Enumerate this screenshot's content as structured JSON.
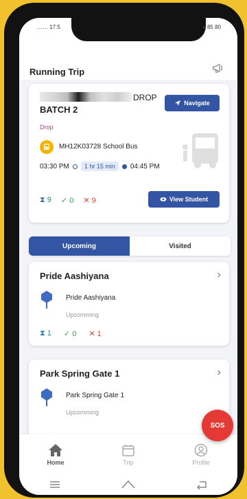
{
  "status": {
    "left": "…… 17:5",
    "right": "● 85 80"
  },
  "header": {
    "title": "Running Trip"
  },
  "trip": {
    "trip_type": "DROP",
    "batch": "BATCH 2",
    "navigate_label": "Navigate",
    "drop_label": "Drop",
    "vehicle": "MH12K03728 School Bus",
    "start_time": "03:30 PM",
    "duration": "1 hr 15 min",
    "end_time": "04:45 PM",
    "total": "9",
    "boarded": "0",
    "absent": "9",
    "view_student_label": "View Student"
  },
  "tabs": [
    {
      "label": "Upcoming",
      "active": true
    },
    {
      "label": "Visited",
      "active": false
    }
  ],
  "stops": [
    {
      "name": "Pride Aashiyana",
      "sub": "Pride Aashiyana",
      "status": "Upcomming",
      "total": "1",
      "boarded": "0",
      "absent": "1"
    },
    {
      "name": "Park Spring Gate 1",
      "sub": "Park Spring Gate 1",
      "status": "Upcomming"
    }
  ],
  "sos_label": "SOS",
  "nav": [
    {
      "label": "Home",
      "icon": "home-icon"
    },
    {
      "label": "Trip",
      "icon": "calendar-icon"
    },
    {
      "label": "Profile",
      "icon": "profile-icon"
    }
  ],
  "colors": {
    "primary": "#3454a4",
    "accent_yellow": "#f2c12e",
    "sos_red": "#e53935",
    "drop_pink": "#c0399e"
  }
}
